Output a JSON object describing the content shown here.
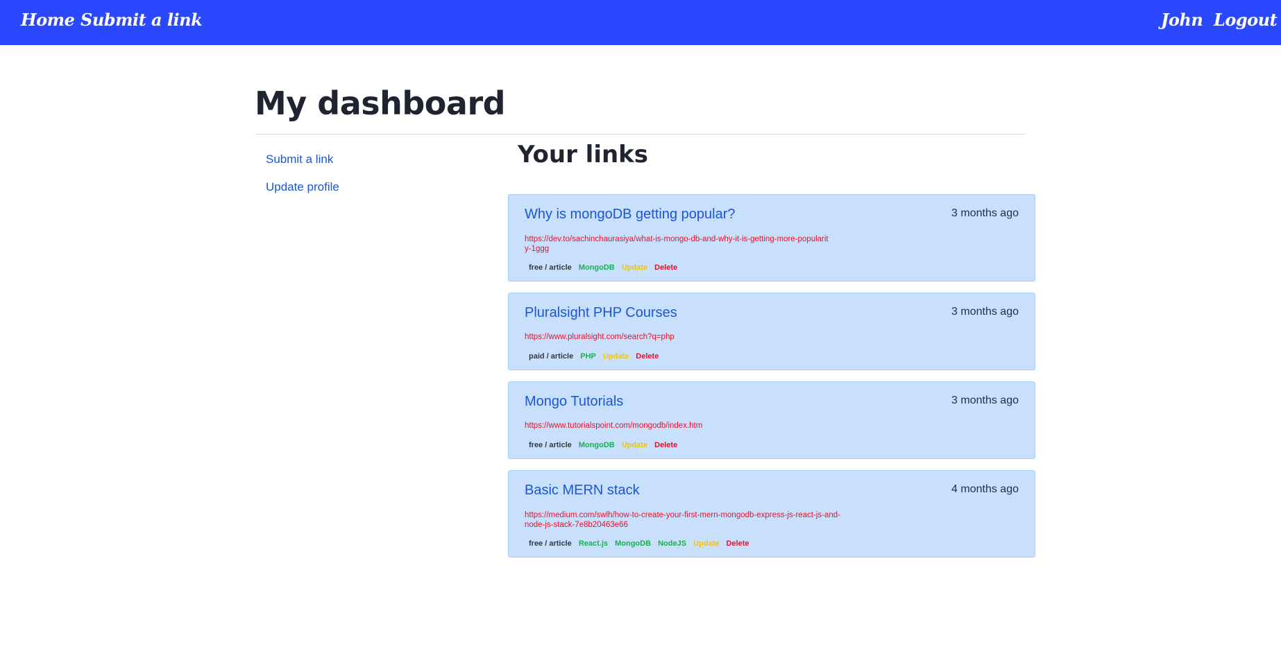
{
  "nav": {
    "home": "Home",
    "submit": "Submit a link",
    "user": "John",
    "logout": "Logout"
  },
  "page": {
    "title": "My dashboard"
  },
  "sidebar": {
    "items": [
      {
        "label": "Submit a link"
      },
      {
        "label": "Update profile"
      }
    ]
  },
  "main": {
    "heading": "Your links",
    "links": [
      {
        "title": "Why is mongoDB getting popular?",
        "time": "3 months ago",
        "url": "https://dev.to/sachinchaurasiya/what-is-mongo-db-and-why-it-is-getting-more-popularity-1ggg",
        "type": "free / article",
        "topics": [
          "MongoDB"
        ],
        "update": "Update",
        "delete": "Delete"
      },
      {
        "title": "Pluralsight PHP Courses",
        "time": "3 months ago",
        "url": "https://www.pluralsight.com/search?q=php",
        "type": "paid / article",
        "topics": [
          "PHP"
        ],
        "update": "Update",
        "delete": "Delete"
      },
      {
        "title": "Mongo Tutorials",
        "time": "3 months ago",
        "url": "https://www.tutorialspoint.com/mongodb/index.htm",
        "type": "free / article",
        "topics": [
          "MongoDB"
        ],
        "update": "Update",
        "delete": "Delete"
      },
      {
        "title": "Basic MERN stack",
        "time": "4 months ago",
        "url": "https://medium.com/swlh/how-to-create-your-first-mern-mongodb-express-js-react-js-and-node-js-stack-7e8b20463e66",
        "type": "free / article",
        "topics": [
          "React.js",
          "MongoDB",
          "NodeJS"
        ],
        "update": "Update",
        "delete": "Delete"
      }
    ]
  },
  "colors": {
    "navbar": "#2a49ff",
    "card_bg": "#c9e0fd",
    "link": "#1a55d6",
    "url": "#e8102a",
    "topic": "#15b24c",
    "update": "#f4c20d",
    "delete": "#e8102a"
  }
}
